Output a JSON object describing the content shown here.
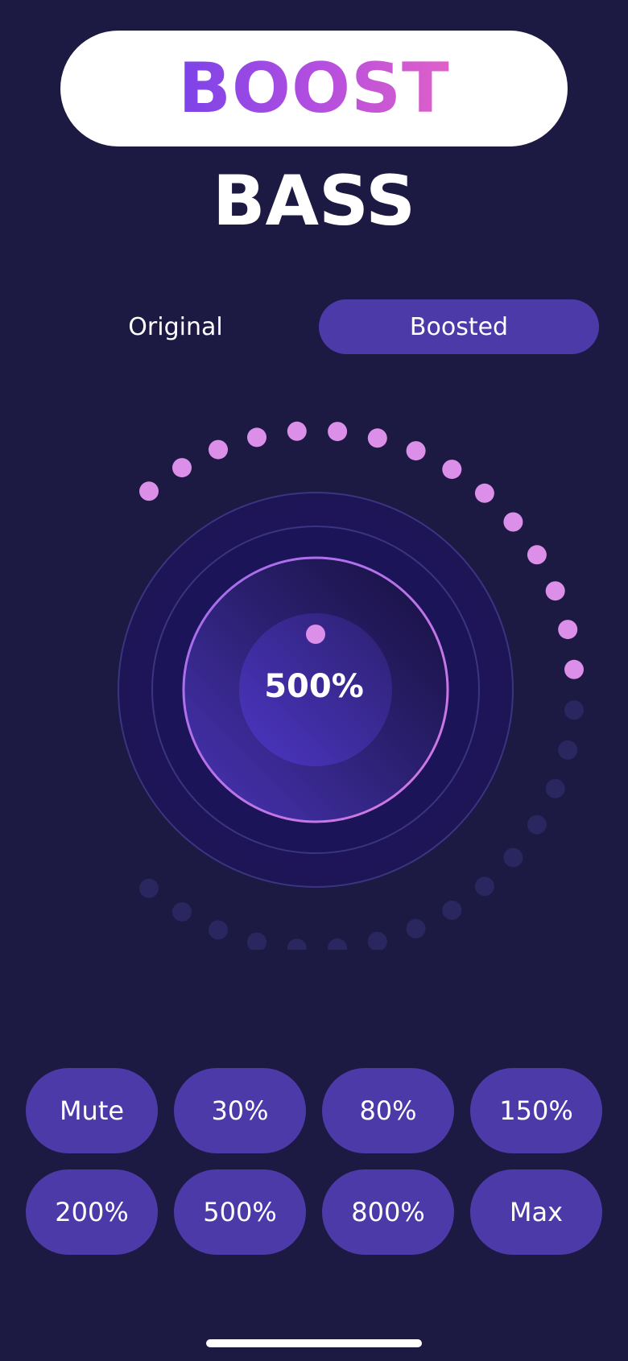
{
  "header": {
    "title": "BOOST",
    "subtitle": "BASS"
  },
  "mode_toggle": {
    "original_label": "Original",
    "boosted_label": "Boosted",
    "selected": "Boosted"
  },
  "dial": {
    "value_label": "500%",
    "level_fraction": 0.5,
    "total_dots": 30,
    "active_color": "#dc8fe8",
    "inactive_color": "#2a2760"
  },
  "presets": [
    {
      "label": "Mute"
    },
    {
      "label": "30%"
    },
    {
      "label": "80%"
    },
    {
      "label": "150%"
    },
    {
      "label": "200%"
    },
    {
      "label": "500%"
    },
    {
      "label": "800%"
    },
    {
      "label": "Max"
    }
  ],
  "colors": {
    "background": "#1c1942",
    "accent": "#4b3aa8",
    "title_gradient_start": "#7b43e8",
    "title_gradient_end": "#e060c8"
  }
}
